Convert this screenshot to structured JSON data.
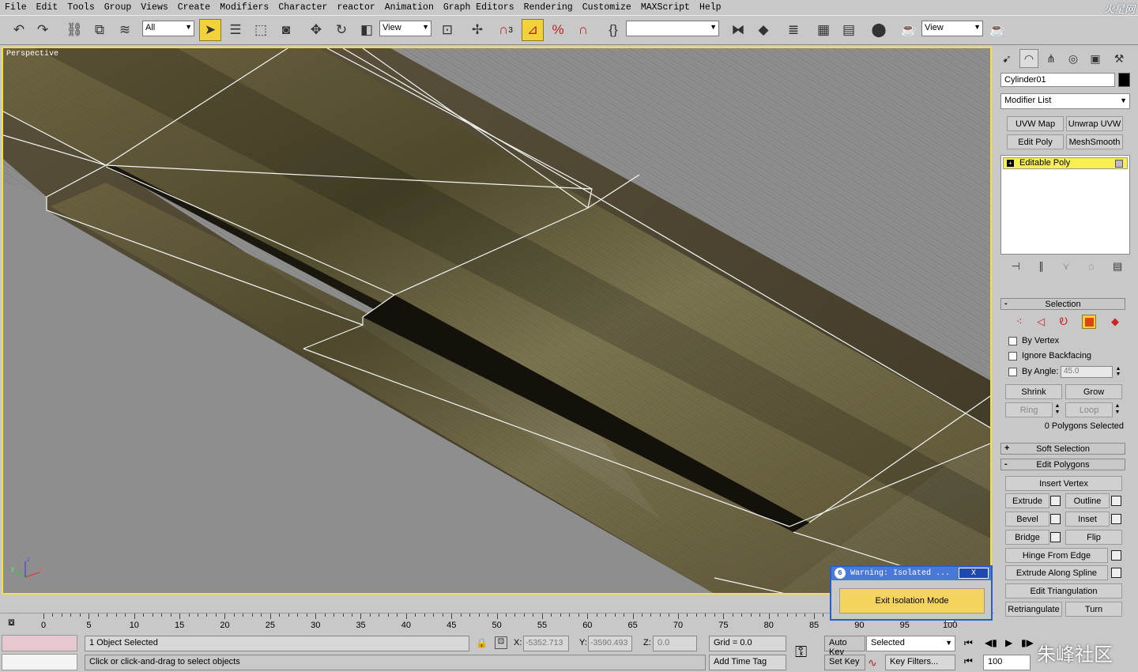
{
  "menu": [
    "File",
    "Edit",
    "Tools",
    "Group",
    "Views",
    "Create",
    "Modifiers",
    "Character",
    "reactor",
    "Animation",
    "Graph Editors",
    "Rendering",
    "Customize",
    "MAXScript",
    "Help"
  ],
  "logo_text": "火星网",
  "toolbar": {
    "filter_select": "All",
    "refcoord_select": "View",
    "named_sel_select": "",
    "render_view_select": "View",
    "icons": [
      "undo-icon",
      "redo-icon",
      "select-link-icon",
      "unlink-icon",
      "bind-spacewarp-icon",
      "select-object-icon",
      "select-by-name-icon",
      "rect-region-icon",
      "window-crossing-icon",
      "move-icon",
      "rotate-icon",
      "scale-icon",
      "pivot-icon",
      "manipulate-icon",
      "snap-3-icon",
      "angle-snap-icon",
      "percent-snap-icon",
      "spinner-snap-icon",
      "edit-named-sel-icon",
      "mirror-icon",
      "align-icon",
      "layer-manager-icon",
      "curve-editor-icon",
      "schematic-view-icon",
      "material-editor-icon",
      "render-setup-icon",
      "quick-render-icon"
    ],
    "snap_label": "3"
  },
  "viewport": {
    "label": "Perspective",
    "axis_x": "x",
    "axis_y": "y",
    "axis_z": "z"
  },
  "command_panel": {
    "tabs": [
      "create-tab-icon",
      "modify-tab-icon",
      "hierarchy-tab-icon",
      "motion-tab-icon",
      "display-tab-icon",
      "utilities-tab-icon"
    ],
    "object_name": "Cylinder01",
    "object_color": "#000000",
    "modifier_list": "Modifier List",
    "modifier_buttons": [
      "UVW Map",
      "Unwrap UVW",
      "Edit Poly",
      "MeshSmooth"
    ],
    "stack_item": "Editable Poly",
    "stack_tool_icons": [
      "pin-stack-icon",
      "show-end-result-icon",
      "make-unique-icon",
      "remove-modifier-icon",
      "configure-sets-icon"
    ],
    "selection": {
      "title": "Selection",
      "by_vertex": "By Vertex",
      "ignore_backfacing": "Ignore Backfacing",
      "by_angle": "By Angle:",
      "angle_value": "45.0",
      "shrink": "Shrink",
      "grow": "Grow",
      "ring": "Ring",
      "loop": "Loop",
      "status": "0 Polygons Selected"
    },
    "soft_selection": "Soft Selection",
    "edit_polygons": {
      "title": "Edit Polygons",
      "insert_vertex": "Insert Vertex",
      "extrude": "Extrude",
      "outline": "Outline",
      "bevel": "Bevel",
      "inset": "Inset",
      "bridge": "Bridge",
      "flip": "Flip",
      "hinge": "Hinge From Edge",
      "extrude_spline": "Extrude Along Spline",
      "edit_triangulation": "Edit Triangulation",
      "retriangulate": "Retriangulate",
      "turn": "Turn"
    }
  },
  "timeline": {
    "ticks": [
      "0",
      "5",
      "10",
      "15",
      "20",
      "25",
      "30",
      "35",
      "40",
      "45",
      "50",
      "55",
      "60",
      "65",
      "70",
      "75",
      "80",
      "85",
      "90",
      "95",
      "100"
    ]
  },
  "warning": {
    "title": "Warning: Isolated ...",
    "close": "X",
    "exit_button": "Exit Isolation Mode"
  },
  "status": {
    "selected_count": "1 Object Selected",
    "prompt": "Click or click-and-drag to select objects",
    "x_label": "X:",
    "x_value": "-5352.713",
    "y_label": "Y:",
    "y_value": "-3590.493",
    "z_label": "Z:",
    "z_value": "0.0",
    "grid": "Grid = 0.0",
    "add_time_tag": "Add Time Tag",
    "auto_key": "Auto Key",
    "set_key": "Set Key",
    "key_mode": "Selected",
    "key_filters": "Key Filters...",
    "frame": "100",
    "watermark": "朱峰社区"
  }
}
